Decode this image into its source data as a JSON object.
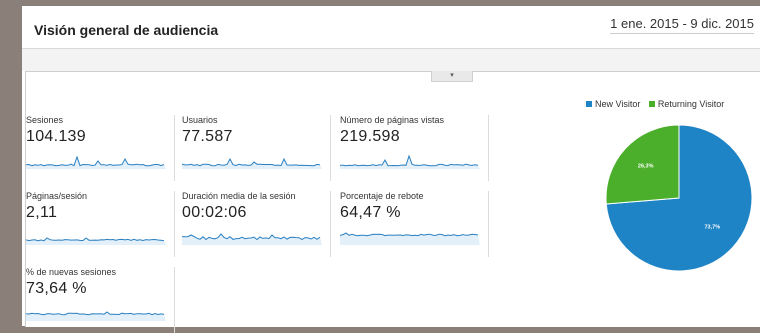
{
  "header": {
    "title": "Visión general de audiencia",
    "date_range": "1 ene. 2015 - 9 dic. 2015"
  },
  "toggle": {
    "icon": "chevron-down-icon",
    "glyph": "▾"
  },
  "metrics": [
    {
      "label": "Sesiones",
      "value": "104.139"
    },
    {
      "label": "Usuarios",
      "value": "77.587"
    },
    {
      "label": "Número de páginas vistas",
      "value": "219.598"
    },
    {
      "label": "Páginas/sesión",
      "value": "2,11"
    },
    {
      "label": "Duración media de la sesión",
      "value": "00:02:06"
    },
    {
      "label": "Porcentaje de rebote",
      "value": "64,47 %"
    },
    {
      "label": "% de nuevas sesiones",
      "value": "73,64 %"
    }
  ],
  "colors": {
    "new_visitor": "#1f84c6",
    "returning_visitor": "#4caf2c",
    "sparkline": "#2a7fc0",
    "sparkline_fill": "#e3f0fa"
  },
  "chart_data": {
    "type": "pie",
    "legend_position": "top",
    "series": [
      {
        "name": "New Visitor",
        "value": 73.7,
        "label": "73,7%",
        "color": "#1f84c6"
      },
      {
        "name": "Returning Visitor",
        "value": 26.3,
        "label": "26,3%",
        "color": "#4caf2c"
      }
    ]
  }
}
